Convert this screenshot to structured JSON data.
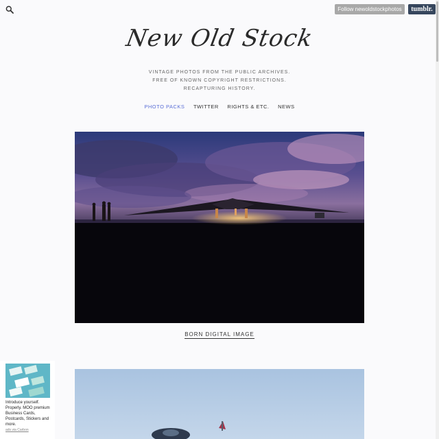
{
  "header": {
    "follow_label": "Follow newoldstockphotos",
    "tumblr_label": "tumblr."
  },
  "site": {
    "title": "New Old Stock",
    "tagline": [
      "VINTAGE PHOTOS FROM THE PUBLIC ARCHIVES.",
      "FREE OF KNOWN COPYRIGHT RESTRICTIONS.",
      "RECAPTURING HISTORY."
    ]
  },
  "nav": {
    "items": [
      "PHOTO PACKS",
      "TWITTER",
      "RIGHTS & ETC.",
      "NEWS"
    ],
    "active_color": "#5b6fd6"
  },
  "posts": [
    {
      "caption": "BORN DIGITAL IMAGE"
    }
  ],
  "ad": {
    "text": "Introduce yourself. Properly. MOO premium Business Cards, Postcards, Stickers and more.",
    "via": "ads via Carbon"
  },
  "icons": [
    "search-icon"
  ]
}
